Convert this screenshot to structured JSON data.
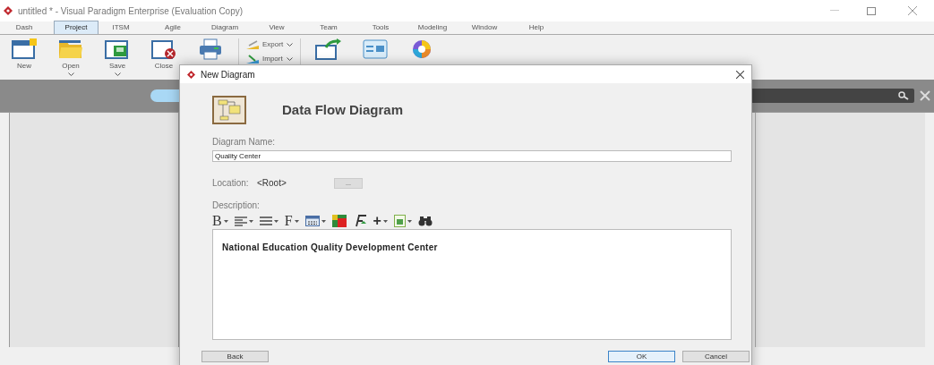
{
  "window": {
    "title": "untitled * - Visual Paradigm Enterprise (Evaluation Copy)"
  },
  "tabs": [
    {
      "label": "Dash",
      "selected": false
    },
    {
      "label": "Project",
      "selected": true
    },
    {
      "label": "ITSM",
      "selected": false
    },
    {
      "label": "Agile",
      "selected": false
    },
    {
      "label": "Diagram",
      "selected": false
    },
    {
      "label": "View",
      "selected": false
    },
    {
      "label": "Team",
      "selected": false
    },
    {
      "label": "Tools",
      "selected": false
    },
    {
      "label": "Modeling",
      "selected": false
    },
    {
      "label": "Window",
      "selected": false
    },
    {
      "label": "Help",
      "selected": false
    }
  ],
  "ribbon": [
    {
      "kind": "large",
      "label": "New",
      "dropdown": false
    },
    {
      "kind": "large",
      "label": "Open",
      "dropdown": true
    },
    {
      "kind": "large",
      "label": "Save",
      "dropdown": true
    },
    {
      "kind": "large",
      "label": "Close",
      "dropdown": false
    },
    {
      "kind": "large",
      "dropdown": false
    },
    {
      "kind": "small",
      "items": [
        "Export",
        "Import"
      ]
    },
    {
      "kind": "large",
      "dropdown": false
    },
    {
      "kind": "large",
      "dropdown": false
    },
    {
      "kind": "large",
      "dropdown": false
    }
  ],
  "dialog": {
    "title": "New Diagram",
    "heading": "Data Flow Diagram",
    "name_label": "Diagram Name:",
    "name_value": "Quality Center",
    "location_label": "Location:",
    "location_value": "<Root>",
    "browse_button": "...",
    "description_label": "Description:",
    "toolbar": [
      {
        "kind": "glyph",
        "text": "B",
        "dropdown": true
      },
      {
        "kind": "icon",
        "dropdown": true
      },
      {
        "kind": "icon",
        "dropdown": true
      },
      {
        "kind": "glyph",
        "text": "F",
        "dropdown": true
      },
      {
        "kind": "icon",
        "dropdown": true
      },
      {
        "kind": "icon",
        "dropdown": false
      },
      {
        "kind": "icon",
        "dropdown": false
      },
      {
        "kind": "glyph",
        "text": "+",
        "dropdown": true
      },
      {
        "kind": "icon",
        "dropdown": true
      },
      {
        "kind": "icon",
        "dropdown": false
      }
    ],
    "description": "National Education Quality Development Center",
    "buttons": [
      {
        "label": "Back",
        "selected": false
      },
      {
        "label": "OK",
        "selected": true
      },
      {
        "label": "Cancel",
        "selected": false
      }
    ]
  }
}
